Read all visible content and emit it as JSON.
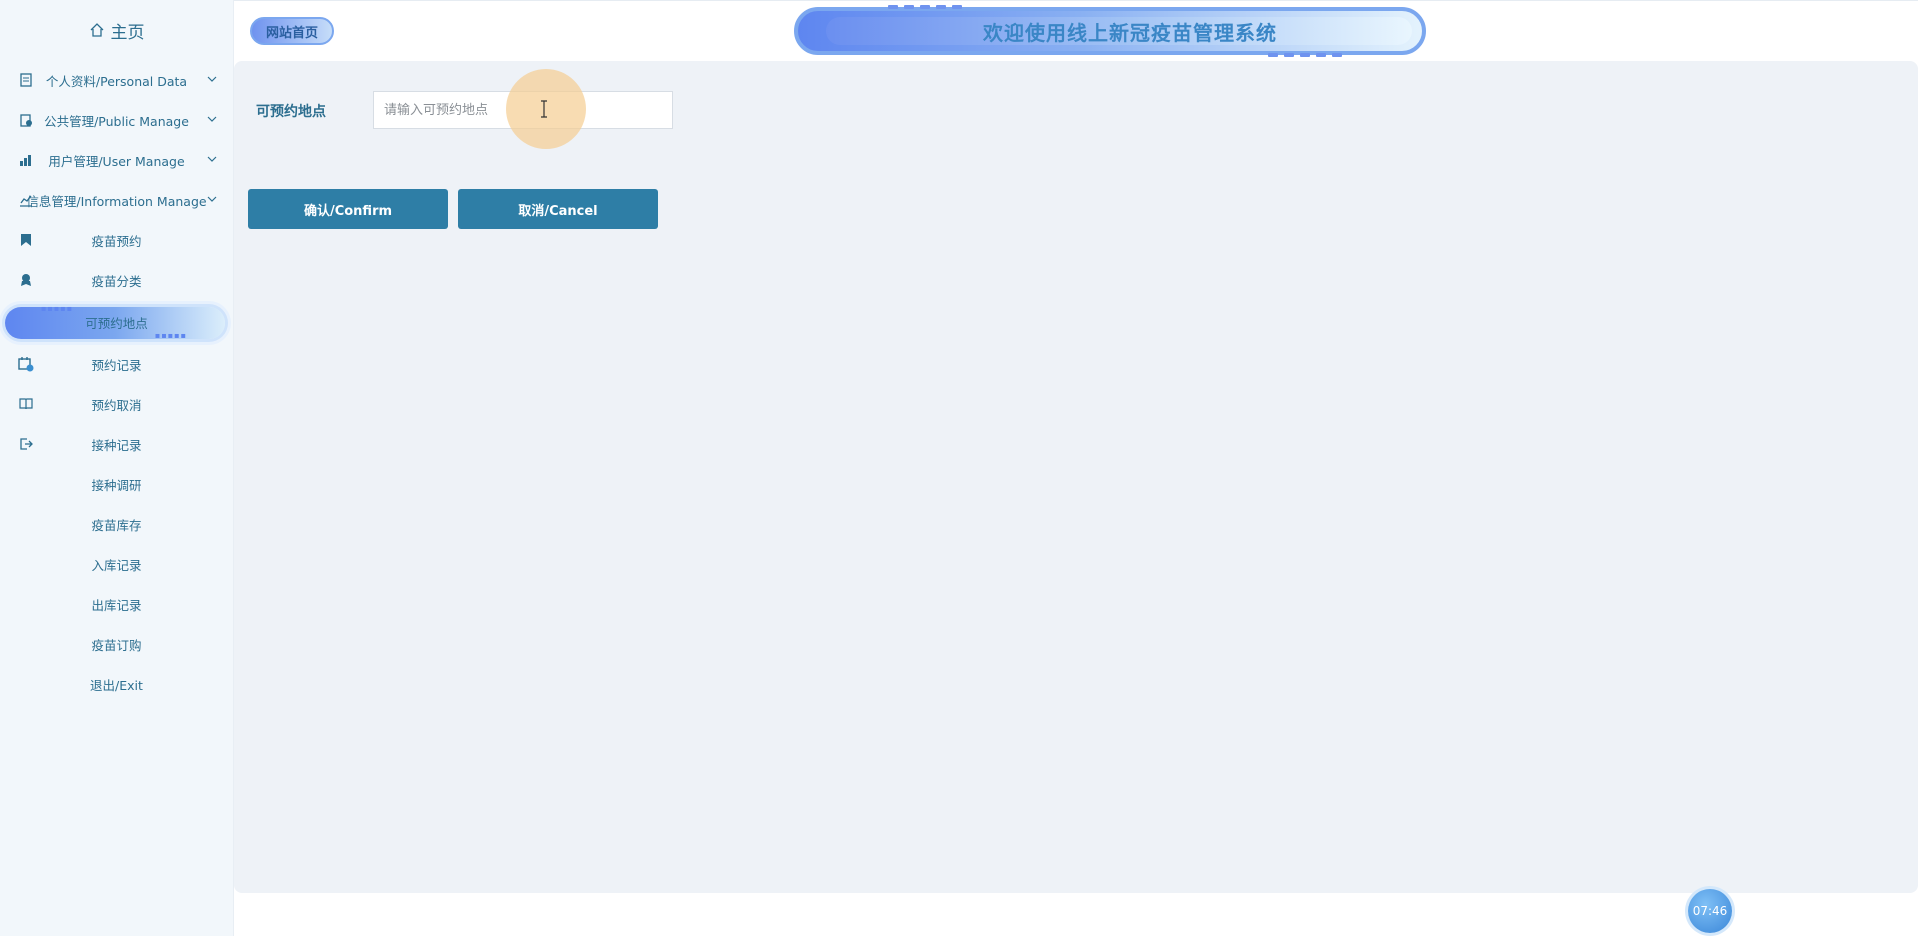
{
  "sidebar": {
    "home_label": "主页",
    "groups": [
      {
        "label": "个人资料/Personal Data"
      },
      {
        "label": "公共管理/Public Manage"
      },
      {
        "label": "用户管理/User Manage"
      },
      {
        "label": "信息管理/Information Manage"
      }
    ],
    "items": [
      {
        "label": "疫苗预约",
        "icon": "bookmark-icon"
      },
      {
        "label": "疫苗分类",
        "icon": "award-icon"
      },
      {
        "label": "可预约地点",
        "icon": "",
        "active": true
      },
      {
        "label": "预约记录",
        "icon": "calendar-check-icon"
      },
      {
        "label": "预约取消",
        "icon": "book-icon"
      },
      {
        "label": "接种记录",
        "icon": "sign-out-icon"
      },
      {
        "label": "接种调研",
        "icon": ""
      },
      {
        "label": "疫苗库存",
        "icon": ""
      },
      {
        "label": "入库记录",
        "icon": ""
      },
      {
        "label": "出库记录",
        "icon": ""
      },
      {
        "label": "疫苗订购",
        "icon": ""
      },
      {
        "label": "退出/Exit",
        "icon": ""
      }
    ]
  },
  "header": {
    "home_badge": "网站首页",
    "title": "欢迎使用线上新冠疫苗管理系统"
  },
  "form": {
    "location_label": "可预约地点",
    "location_value": "",
    "location_placeholder": "请输入可预约地点",
    "confirm_label": "确认/Confirm",
    "cancel_label": "取消/Cancel"
  },
  "clock": {
    "time": "07:46"
  },
  "colors": {
    "accent": "#2e7ea6",
    "text": "#2c6e8f",
    "main_bg": "#eef2f7",
    "sidebar_bg": "#f2f7fb"
  }
}
